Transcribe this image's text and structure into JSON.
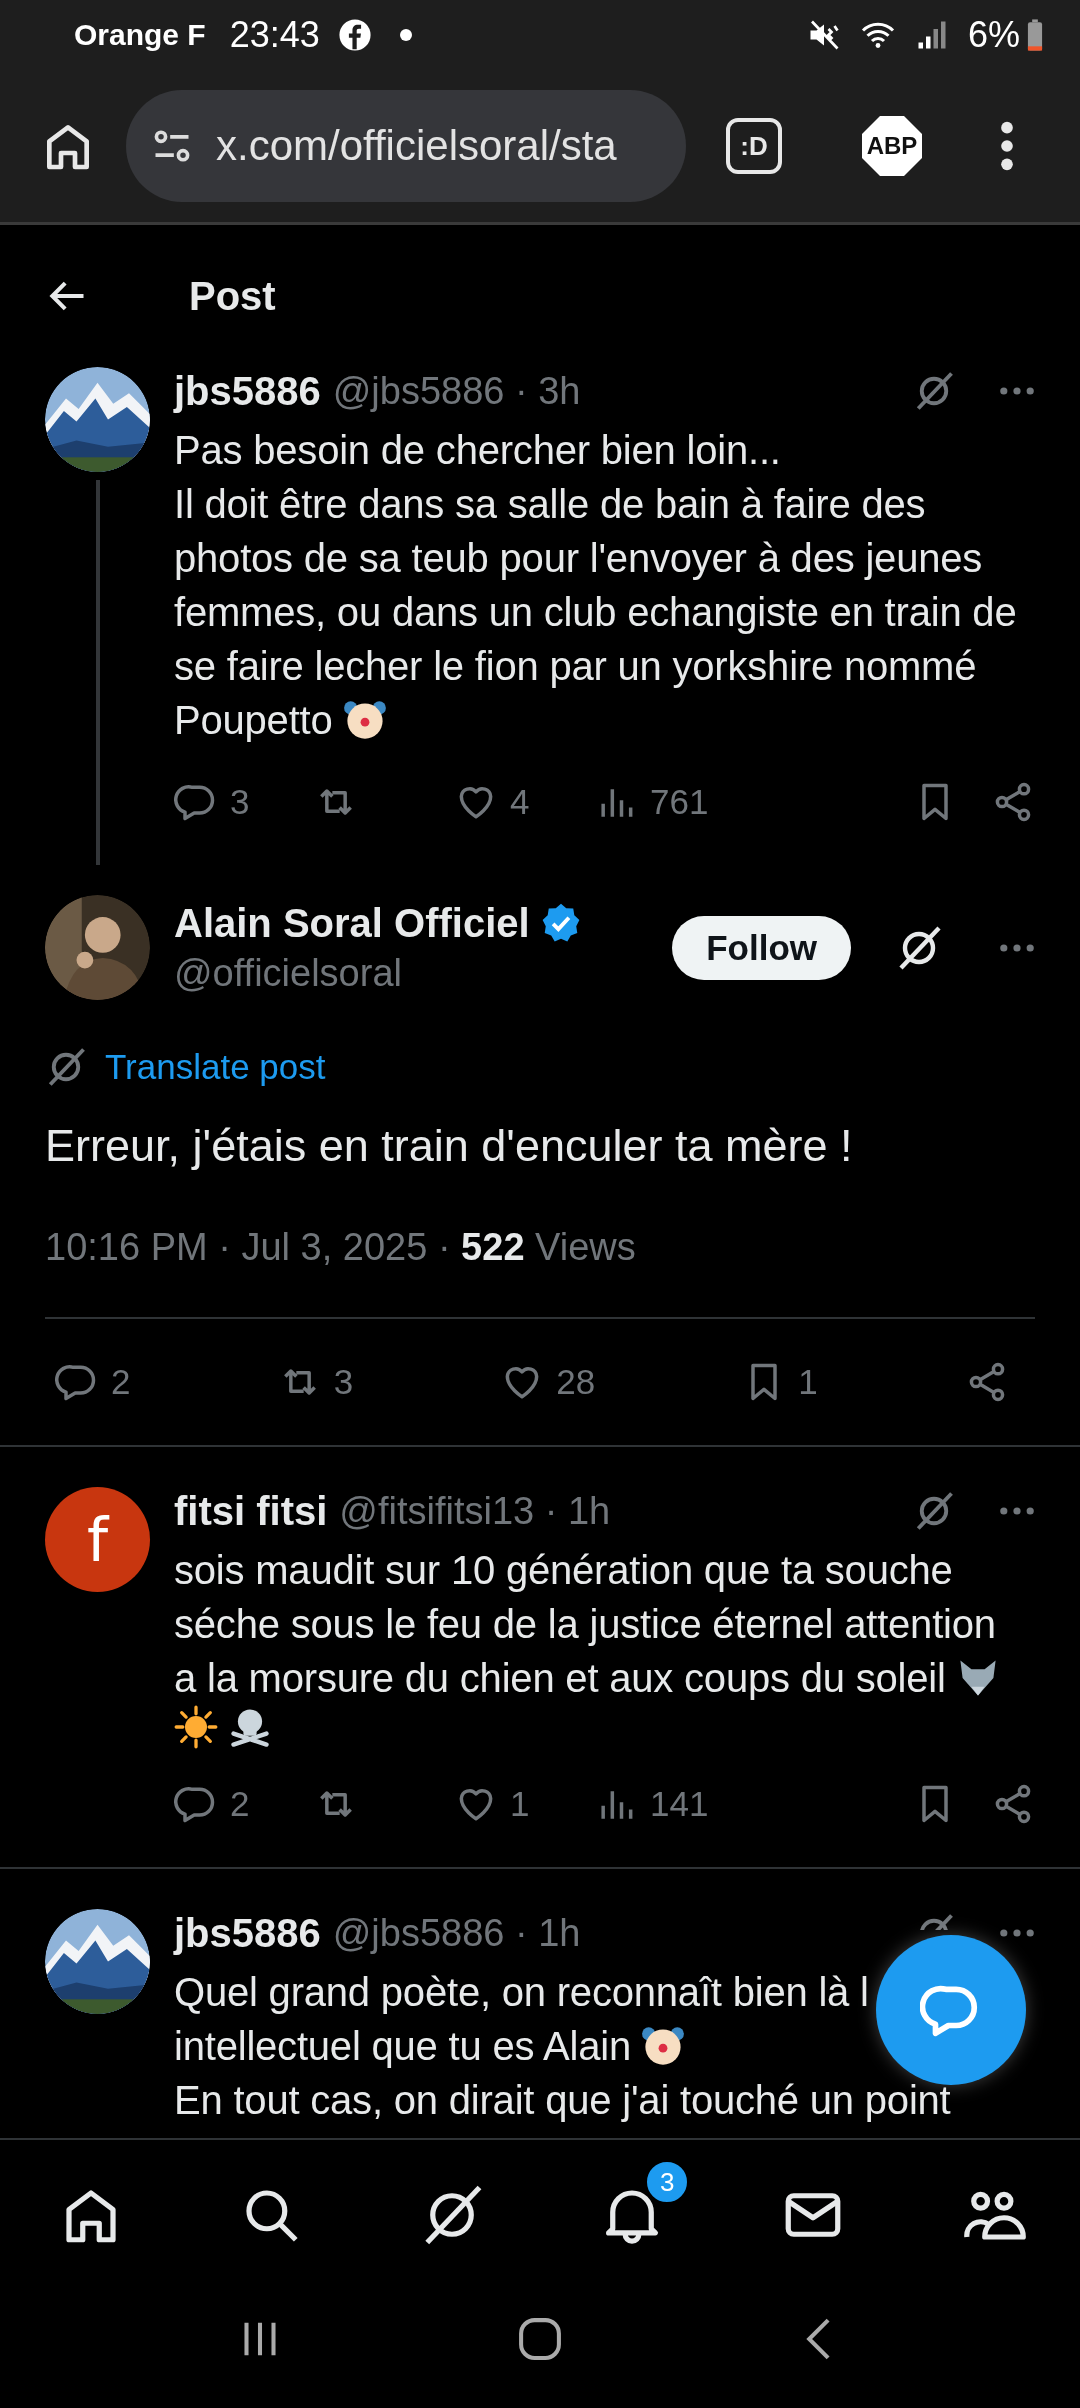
{
  "status_bar": {
    "carrier": "Orange F",
    "time": "23:43",
    "battery": "6%"
  },
  "browser": {
    "url": "x.com/officielsoral/sta",
    "extensions": [
      {
        "kind": "square",
        "label": ":D"
      },
      {
        "kind": "octagon",
        "label": "ABP"
      }
    ]
  },
  "header": {
    "title": "Post"
  },
  "posts": [
    {
      "kind": "reply",
      "thread": true,
      "avatar": {
        "kind": "picture"
      },
      "name": "jbs5886",
      "meta": "@jbs5886 · 3h",
      "lines": [
        [
          {
            "kind": "text",
            "text": "Pas besoin de chercher bien loin..."
          }
        ],
        [
          {
            "kind": "text",
            "text": "Il doit être dans sa salle de bain à faire des photos de sa teub pour l'envoyer à des jeunes femmes, ou dans un club echangiste en train de se faire lecher le fion par un yorkshire nommé"
          }
        ],
        [
          {
            "kind": "text",
            "text": "Poupetto"
          },
          {
            "kind": "clown"
          }
        ]
      ],
      "actions": [
        {
          "kind": "reply",
          "count": "3"
        },
        {
          "kind": "retweet"
        },
        {
          "kind": "like",
          "count": "4"
        },
        {
          "kind": "views",
          "count": "761"
        },
        {
          "kind": "bookmark"
        },
        {
          "kind": "share"
        }
      ]
    },
    {
      "kind": "main",
      "avatar": {
        "kind": "picture"
      },
      "name": "Alain Soral Officiel",
      "verified": true,
      "meta": "@officielsoral",
      "follow_label": "Follow",
      "translate_label": "Translate post",
      "body": [
        {
          "kind": "text",
          "text": "Erreur, j'étais en train d'enculer ta mère !"
        }
      ],
      "stamp": "10:16 PM · Jul 3, 2025 · **522** Views",
      "actions": [
        {
          "kind": "reply",
          "count": "2"
        },
        {
          "kind": "retweet",
          "count": "3"
        },
        {
          "kind": "like",
          "count": "28"
        },
        {
          "kind": "bookmark",
          "count": "1"
        },
        {
          "kind": "share"
        }
      ]
    },
    {
      "kind": "reply",
      "thread": false,
      "avatar": {
        "kind": "letter",
        "letter": "f",
        "color": "#c8360f"
      },
      "name": "fitsi fitsi",
      "meta": "@fitsifitsi13 · 1h",
      "lines": [
        [
          {
            "kind": "text",
            "text": "sois maudit sur 10 génération que ta souche séche sous le feu de la justice éternel attention"
          }
        ],
        [
          {
            "kind": "text",
            "text": "a la morsure du chien et aux coups du soleil"
          },
          {
            "kind": "wolf"
          }
        ],
        [
          {
            "kind": "sun"
          },
          {
            "kind": "skull"
          }
        ]
      ],
      "actions": [
        {
          "kind": "reply",
          "count": "2"
        },
        {
          "kind": "retweet"
        },
        {
          "kind": "like",
          "count": "1"
        },
        {
          "kind": "views",
          "count": "141"
        },
        {
          "kind": "bookmark"
        },
        {
          "kind": "share"
        }
      ]
    },
    {
      "kind": "reply",
      "thread": false,
      "avatar": {
        "kind": "picture"
      },
      "name": "jbs5886",
      "meta": "@jbs5886 · 1h",
      "lines": [
        [
          {
            "kind": "text",
            "text": "Quel grand poète, on reconnaît bien là l"
          }
        ],
        [
          {
            "kind": "text",
            "text": "intellectuel que tu es Alain"
          },
          {
            "kind": "clown"
          }
        ],
        [
          {
            "kind": "text",
            "text": "En tout cas, on dirait que j'ai touché un point"
          }
        ]
      ]
    }
  ],
  "bottom_nav": [
    {
      "kind": "home"
    },
    {
      "kind": "search"
    },
    {
      "kind": "grok"
    },
    {
      "kind": "notifications",
      "badge": "3"
    },
    {
      "kind": "messages"
    },
    {
      "kind": "communities"
    }
  ]
}
